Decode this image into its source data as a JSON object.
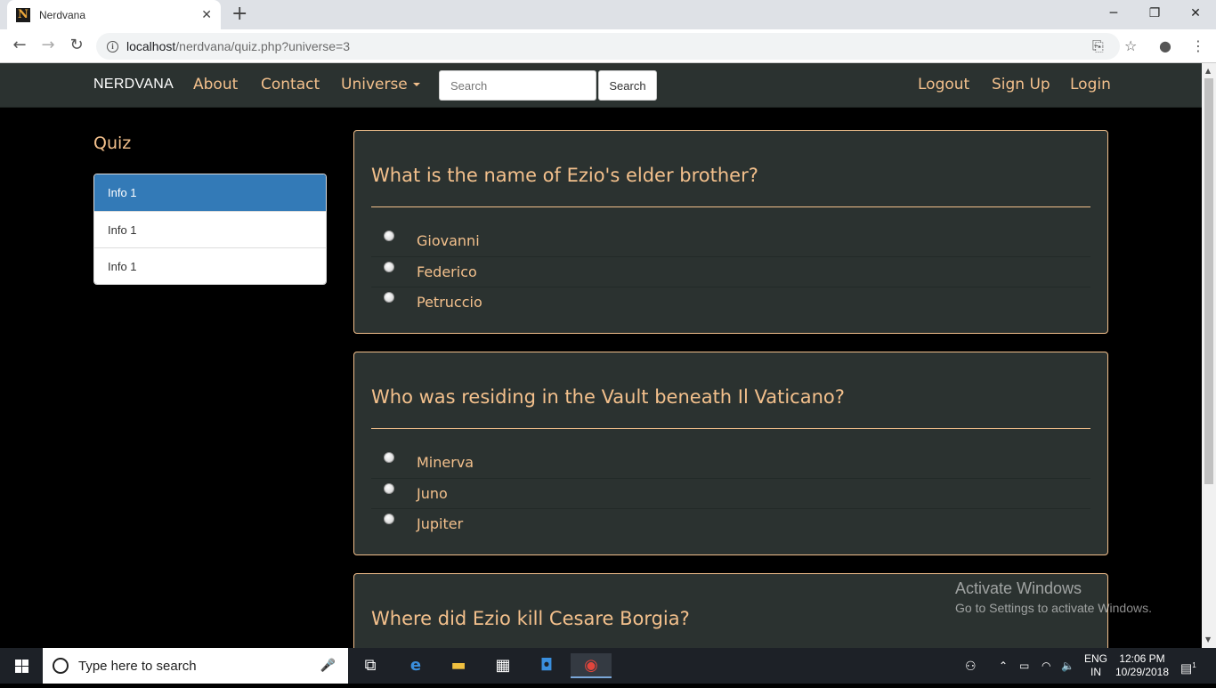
{
  "browser": {
    "tab_title": "Nerdvana",
    "favicon_letter": "N",
    "url_host": "localhost",
    "url_path": "/nerdvana/quiz.php?universe=3"
  },
  "navbar": {
    "brand": "NERDVANA",
    "links": [
      "About",
      "Contact",
      "Universe"
    ],
    "search_placeholder": "Search",
    "search_button": "Search",
    "right_links": [
      "Logout",
      "Sign Up",
      "Login"
    ]
  },
  "sidebar": {
    "title": "Quiz",
    "items": [
      "Info 1",
      "Info 1",
      "Info 1"
    ],
    "active_index": 0
  },
  "questions": [
    {
      "text": "What is the name of Ezio's elder brother?",
      "options": [
        "Giovanni",
        "Federico",
        "Petruccio"
      ]
    },
    {
      "text": "Who was residing in the Vault beneath Il Vaticano?",
      "options": [
        "Minerva",
        "Juno",
        "Jupiter"
      ]
    },
    {
      "text": "Where did Ezio kill Cesare Borgia?",
      "options": []
    }
  ],
  "watermark": {
    "line1": "Activate Windows",
    "line2": "Go to Settings to activate Windows."
  },
  "taskbar": {
    "search_placeholder": "Type here to search",
    "lang": "ENG",
    "region": "IN",
    "time": "12:06 PM",
    "date": "10/29/2018",
    "notification_count": "1"
  }
}
